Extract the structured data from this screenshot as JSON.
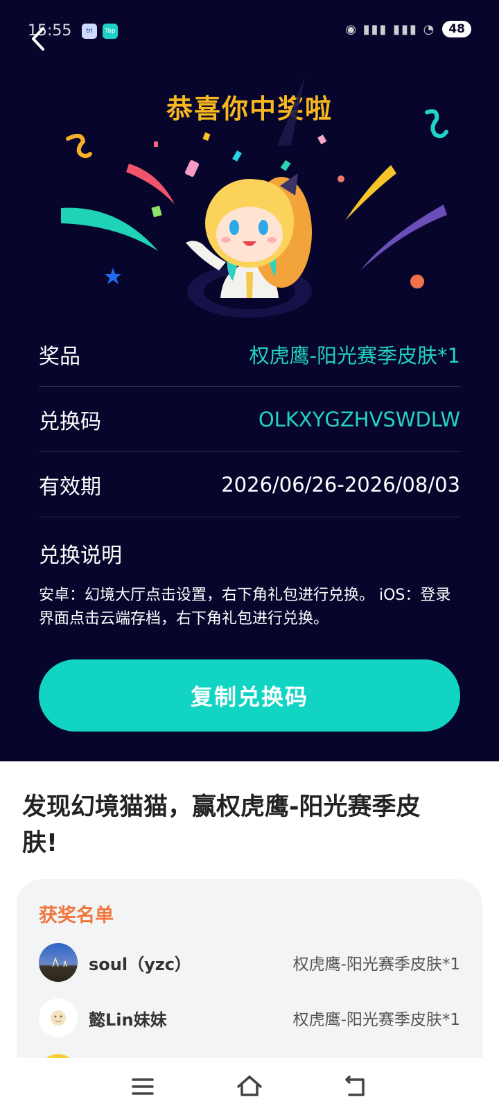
{
  "status_bar": {
    "time": "15:55",
    "battery": "48",
    "app1": "tri",
    "app2": "Tap"
  },
  "header": {
    "title": "恭喜你中奖啦"
  },
  "prize_info": {
    "prize_label": "奖品",
    "prize_value": "权虎鹰-阳光赛季皮肤*1",
    "code_label": "兑换码",
    "code_value": "OLKXYGZHVSWDLW",
    "validity_label": "有效期",
    "validity_value": "2026/06/26-2026/08/03",
    "instructions_title": "兑换说明",
    "instructions_text": "安卓：幻境大厅点击设置，右下角礼包进行兑换。 iOS：登录界面点击云端存档，右下角礼包进行兑换。"
  },
  "copy_button": {
    "label": "复制兑换码"
  },
  "promo": {
    "text": "发现幻境猫猫，赢权虎鹰-阳光赛季皮肤!"
  },
  "winners": {
    "title": "获奖名单",
    "items": [
      {
        "name": "soul（yzc）",
        "prize": "权虎鹰-阳光赛季皮肤*1"
      },
      {
        "name": "懿Lin妹妹",
        "prize": "权虎鹰-阳光赛季皮肤*1"
      }
    ]
  },
  "colors": {
    "background_dark": "#07052b",
    "accent_teal": "#12d4c2",
    "title_gold": "#f7b71f",
    "winners_title": "#f0763c"
  },
  "icons": {
    "back": "back-arrow-icon",
    "menu": "menu-icon",
    "home": "home-icon",
    "return": "return-icon"
  }
}
